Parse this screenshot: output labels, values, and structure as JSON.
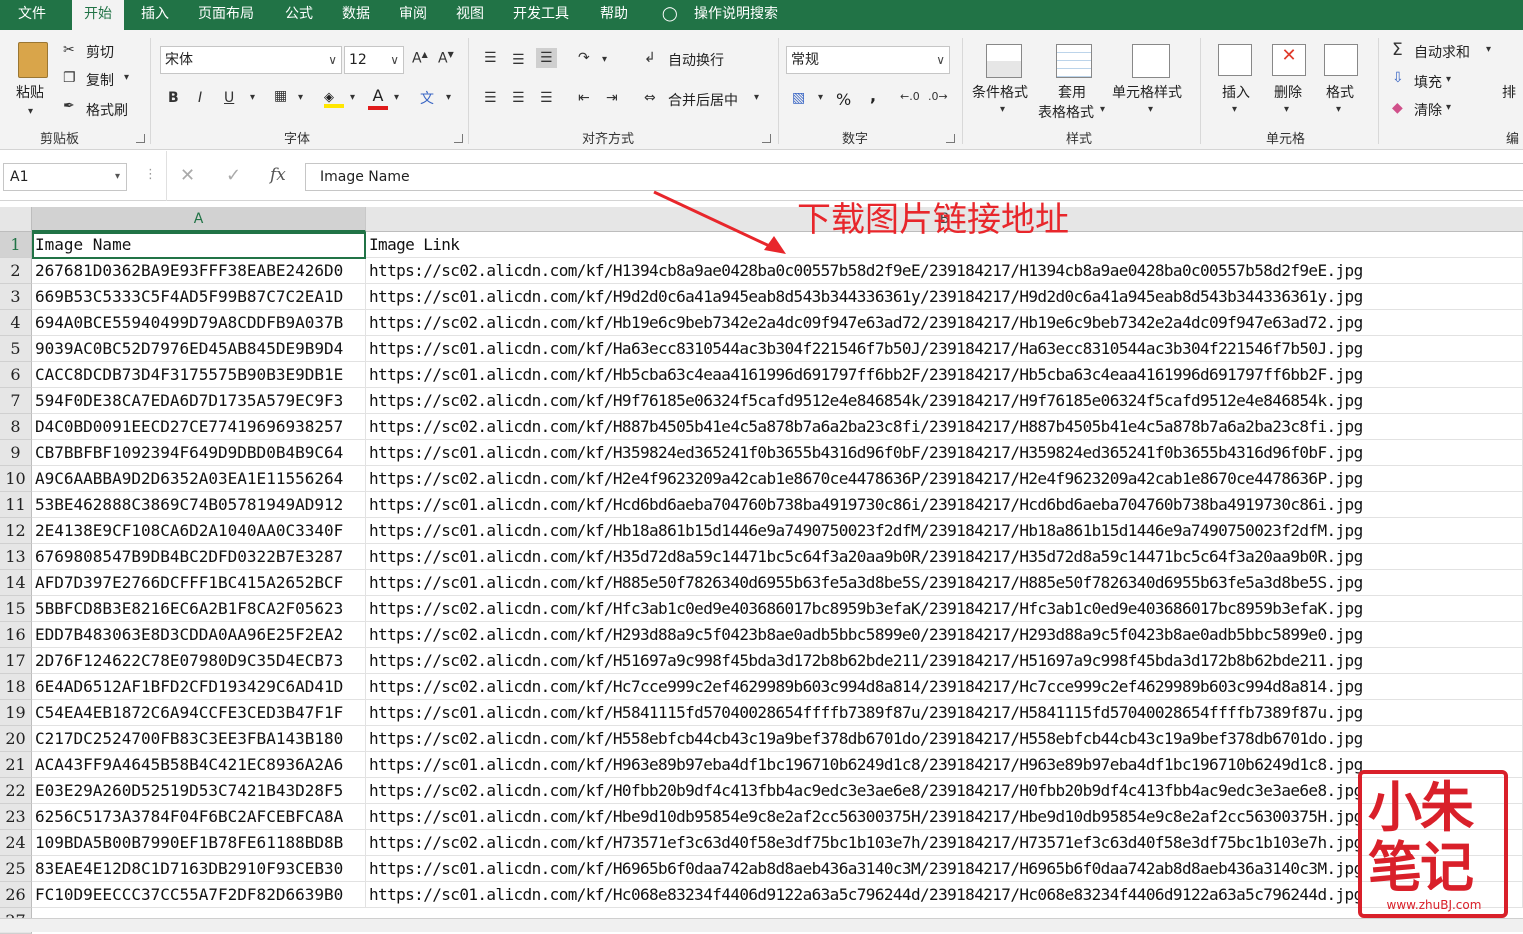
{
  "menu": {
    "tabs": [
      "文件",
      "开始",
      "插入",
      "页面布局",
      "公式",
      "数据",
      "审阅",
      "视图",
      "开发工具",
      "帮助"
    ],
    "search": "操作说明搜索"
  },
  "ribbon": {
    "clipboard": {
      "paste": "粘贴",
      "cut": "剪切",
      "copy": "复制",
      "format_painter": "格式刷",
      "label": "剪贴板"
    },
    "font": {
      "name": "宋体",
      "size": "12",
      "label": "字体"
    },
    "alignment": {
      "wrap": "自动换行",
      "merge": "合并后居中",
      "label": "对齐方式"
    },
    "number": {
      "format": "常规",
      "percent": "%",
      "comma": ",",
      "label": "数字"
    },
    "styles": {
      "conditional": "条件格式",
      "table_format_1": "套用",
      "table_format_2": "表格格式",
      "cell_styles": "单元格样式",
      "label": "样式"
    },
    "cells": {
      "insert": "插入",
      "delete": "删除",
      "format": "格式",
      "label": "单元格"
    },
    "editing": {
      "autosum": "自动求和",
      "fill": "填充",
      "clear": "清除",
      "sort": "排",
      "label": "编"
    }
  },
  "formula_bar": {
    "name_box": "A1",
    "fx": "fx",
    "content": "Image Name"
  },
  "grid": {
    "columns": [
      "A",
      "B"
    ],
    "rows": [
      [
        "Image Name",
        "Image Link"
      ],
      [
        "267681D0362BA9E93FFF38EABE2426D0",
        "https://sc02.alicdn.com/kf/H1394cb8a9ae0428ba0c00557b58d2f9eE/239184217/H1394cb8a9ae0428ba0c00557b58d2f9eE.jpg"
      ],
      [
        "669B53C5333C5F4AD5F99B87C7C2EA1D",
        "https://sc01.alicdn.com/kf/H9d2d0c6a41a945eab8d543b344336361y/239184217/H9d2d0c6a41a945eab8d543b344336361y.jpg"
      ],
      [
        "694A0BCE55940499D79A8CDDFB9A037B",
        "https://sc02.alicdn.com/kf/Hb19e6c9beb7342e2a4dc09f947e63ad72/239184217/Hb19e6c9beb7342e2a4dc09f947e63ad72.jpg"
      ],
      [
        "9039AC0BC52D7976ED45AB845DE9B9D4",
        "https://sc01.alicdn.com/kf/Ha63ecc8310544ac3b304f221546f7b50J/239184217/Ha63ecc8310544ac3b304f221546f7b50J.jpg"
      ],
      [
        "CACC8DCDB73D4F3175575B90B3E9DB1E",
        "https://sc01.alicdn.com/kf/Hb5cba63c4eaa4161996d691797ff6bb2F/239184217/Hb5cba63c4eaa4161996d691797ff6bb2F.jpg"
      ],
      [
        "594F0DE38CA7EDA6D7D1735A579EC9F3",
        "https://sc02.alicdn.com/kf/H9f76185e06324f5cafd9512e4e846854k/239184217/H9f76185e06324f5cafd9512e4e846854k.jpg"
      ],
      [
        "D4C0BD0091EECD27CE77419696938257",
        "https://sc02.alicdn.com/kf/H887b4505b41e4c5a878b7a6a2ba23c8fi/239184217/H887b4505b41e4c5a878b7a6a2ba23c8fi.jpg"
      ],
      [
        "CB7BBFBF1092394F649D9DBD0B4B9C64",
        "https://sc01.alicdn.com/kf/H359824ed365241f0b3655b4316d96f0bF/239184217/H359824ed365241f0b3655b4316d96f0bF.jpg"
      ],
      [
        "A9C6AABBA9D2D6352A03EA1E11556264",
        "https://sc02.alicdn.com/kf/H2e4f9623209a42cab1e8670ce4478636P/239184217/H2e4f9623209a42cab1e8670ce4478636P.jpg"
      ],
      [
        "53BE462888C3869C74B05781949AD912",
        "https://sc01.alicdn.com/kf/Hcd6bd6aeba704760b738ba4919730c86i/239184217/Hcd6bd6aeba704760b738ba4919730c86i.jpg"
      ],
      [
        "2E4138E9CF108CA6D2A1040AA0C3340F",
        "https://sc01.alicdn.com/kf/Hb18a861b15d1446e9a7490750023f2dfM/239184217/Hb18a861b15d1446e9a7490750023f2dfM.jpg"
      ],
      [
        "6769808547B9DB4BC2DFD0322B7E3287",
        "https://sc01.alicdn.com/kf/H35d72d8a59c14471bc5c64f3a20aa9b0R/239184217/H35d72d8a59c14471bc5c64f3a20aa9b0R.jpg"
      ],
      [
        "AFD7D397E2766DCFFF1BC415A2652BCF",
        "https://sc01.alicdn.com/kf/H885e50f7826340d6955b63fe5a3d8be5S/239184217/H885e50f7826340d6955b63fe5a3d8be5S.jpg"
      ],
      [
        "5BBFCD8B3E8216EC6A2B1F8CA2F05623",
        "https://sc02.alicdn.com/kf/Hfc3ab1c0ed9e403686017bc8959b3efaK/239184217/Hfc3ab1c0ed9e403686017bc8959b3efaK.jpg"
      ],
      [
        "EDD7B483063E8D3CDDA0AA96E25F2EA2",
        "https://sc02.alicdn.com/kf/H293d88a9c5f0423b8ae0adb5bbc5899e0/239184217/H293d88a9c5f0423b8ae0adb5bbc5899e0.jpg"
      ],
      [
        "2D76F124622C78E07980D9C35D4ECB73",
        "https://sc02.alicdn.com/kf/H51697a9c998f45bda3d172b8b62bde211/239184217/H51697a9c998f45bda3d172b8b62bde211.jpg"
      ],
      [
        "6E4AD6512AF1BFD2CFD193429C6AD41D",
        "https://sc02.alicdn.com/kf/Hc7cce999c2ef4629989b603c994d8a814/239184217/Hc7cce999c2ef4629989b603c994d8a814.jpg"
      ],
      [
        "C54EA4EB1872C6A94CCFE3CED3B47F1F",
        "https://sc01.alicdn.com/kf/H5841115fd57040028654ffffb7389f87u/239184217/H5841115fd57040028654ffffb7389f87u.jpg"
      ],
      [
        "C217DC2524700FB83C3EE3FBA143B180",
        "https://sc02.alicdn.com/kf/H558ebfcb44cb43c19a9bef378db6701do/239184217/H558ebfcb44cb43c19a9bef378db6701do.jpg"
      ],
      [
        "ACA43FF9A4645B58B4C421EC8936A2A6",
        "https://sc01.alicdn.com/kf/H963e89b97eba4df1bc196710b6249d1c8/239184217/H963e89b97eba4df1bc196710b6249d1c8.jpg"
      ],
      [
        "E03E29A260D52519D53C7421B43D28F5",
        "https://sc02.alicdn.com/kf/H0fbb20b9df4c413fbb4ac9edc3e3ae6e8/239184217/H0fbb20b9df4c413fbb4ac9edc3e3ae6e8.jpg"
      ],
      [
        "6256C5173A3784F04F6BC2AFCEBFCA8A",
        "https://sc01.alicdn.com/kf/Hbe9d10db95854e9c8e2af2cc56300375H/239184217/Hbe9d10db95854e9c8e2af2cc56300375H.jpg"
      ],
      [
        "109BDA5B00B7990EF1B78FE61188BD8B",
        "https://sc02.alicdn.com/kf/H73571ef3c63d40f58e3df75bc1b103e7h/239184217/H73571ef3c63d40f58e3df75bc1b103e7h.jpg"
      ],
      [
        "83EAE4E12D8C1D7163DB2910F93CEB30",
        "https://sc01.alicdn.com/kf/H6965b6f0daa742ab8d8aeb436a3140c3M/239184217/H6965b6f0daa742ab8d8aeb436a3140c3M.jpg"
      ],
      [
        "FC10D9EECCC37CC55A7F2DF82D6639B0",
        "https://sc01.alicdn.com/kf/Hc068e83234f4406d9122a63a5c796244d/239184217/Hc068e83234f4406d9122a63a5c796244d.jpg"
      ]
    ]
  },
  "annotation": "下载图片链接地址",
  "watermark": {
    "line1": "小朱",
    "line2": "笔记",
    "url": "www.zhuBJ.com"
  },
  "colors": {
    "excel_green": "#217346",
    "annotation_red": "#e8262b"
  }
}
